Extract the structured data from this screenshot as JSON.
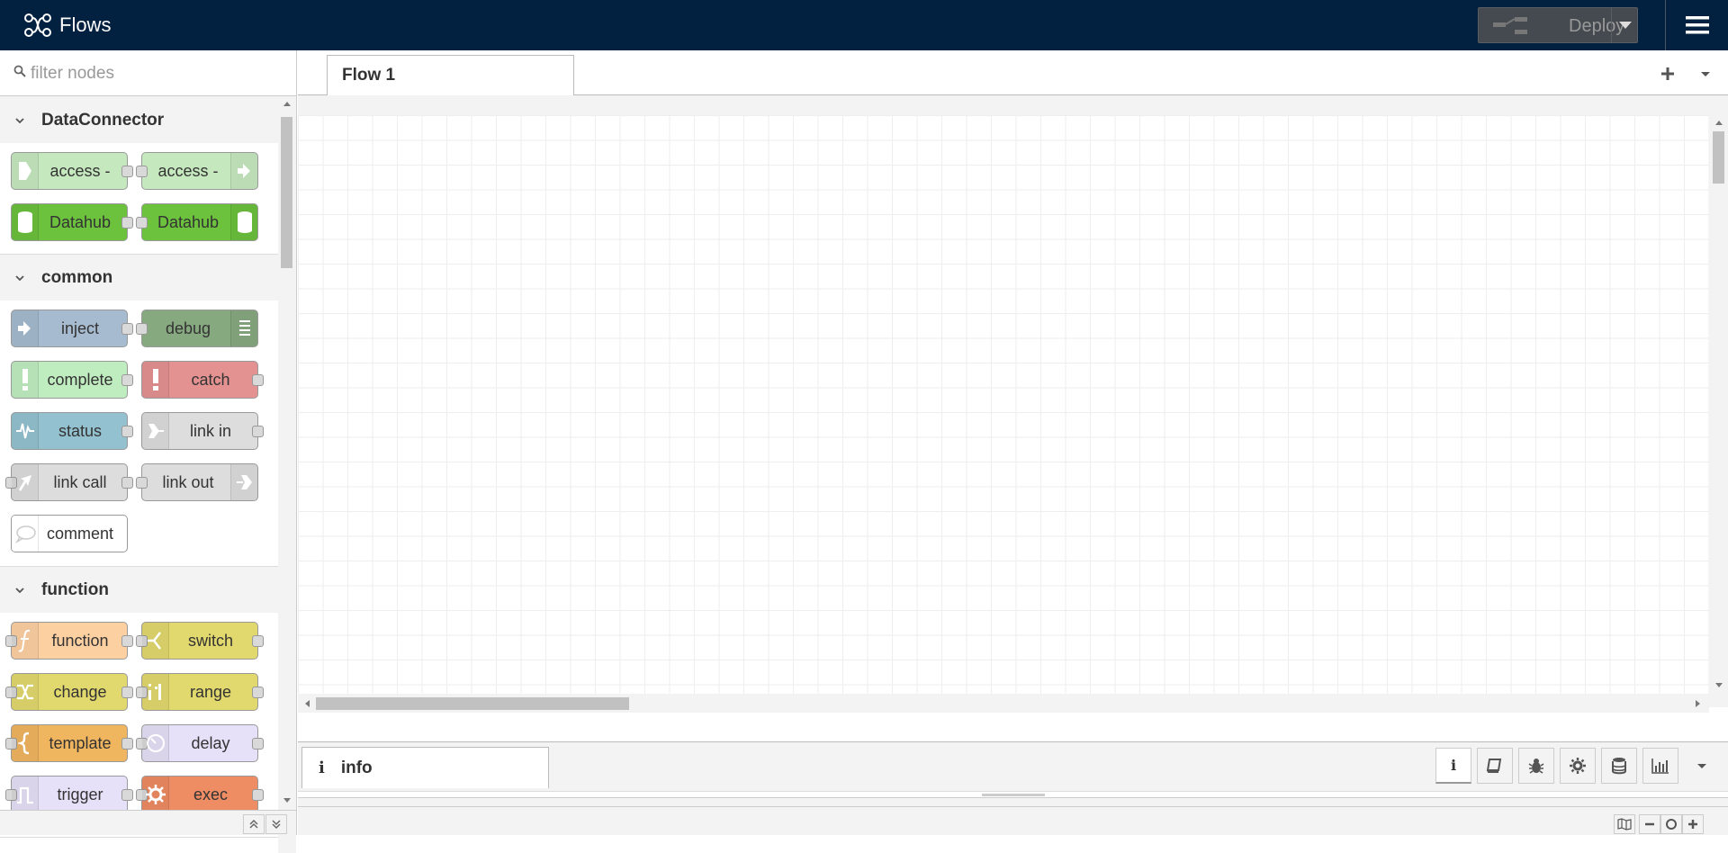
{
  "header": {
    "title": "Flows",
    "deploy_label": "Deploy"
  },
  "palette": {
    "search_placeholder": "filter nodes",
    "categories": [
      {
        "name": "DataConnector",
        "nodes": [
          "access -",
          "access -",
          "Datahub",
          "Datahub"
        ]
      },
      {
        "name": "common",
        "nodes": [
          "inject",
          "debug",
          "complete",
          "catch",
          "status",
          "link in",
          "link call",
          "link out",
          "comment"
        ]
      },
      {
        "name": "function",
        "nodes": [
          "function",
          "switch",
          "change",
          "range",
          "template",
          "delay",
          "trigger",
          "exec"
        ]
      }
    ]
  },
  "workspace": {
    "tabs": [
      {
        "label": "Flow 1"
      }
    ]
  },
  "sidebar": {
    "active_tab": "info"
  },
  "colors": {
    "header_bg": "#02203f",
    "dataconnector_light": "#c6e8bf",
    "dataconnector_dark": "#6cc13d",
    "inject": "#a6bbcf",
    "debug": "#87a980",
    "complete": "#c0edc0",
    "catch": "#e49191",
    "status": "#94c1d0",
    "link": "#dddddd",
    "function": "#fdd0a2",
    "switch": "#e2d96e",
    "template": "#f0b55f",
    "delay": "#e6e0f8",
    "exec": "#ee8c64"
  }
}
